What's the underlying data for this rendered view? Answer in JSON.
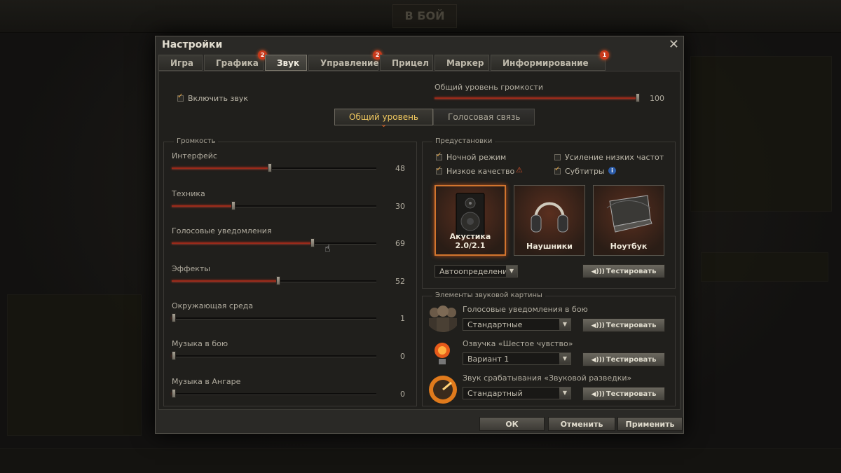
{
  "background": {
    "battle_label": "В БОЙ"
  },
  "dialog": {
    "title": "Настройки",
    "close_glyph": "✕",
    "tabs": [
      {
        "label": "Игра",
        "badge": ""
      },
      {
        "label": "Графика",
        "badge": "2"
      },
      {
        "label": "Звук",
        "badge": ""
      },
      {
        "label": "Управление",
        "badge": "2"
      },
      {
        "label": "Прицел",
        "badge": ""
      },
      {
        "label": "Маркер",
        "badge": ""
      },
      {
        "label": "Информирование в бою",
        "badge": "1"
      }
    ],
    "active_tab": "Звук"
  },
  "sound": {
    "enable_label": "Включить звук",
    "enable_checked": true,
    "master_label": "Общий уровень громкости",
    "master_value": "100",
    "master_fraction": 1.0,
    "segments": [
      "Общий уровень",
      "Голосовая связь"
    ],
    "active_segment": "Общий уровень"
  },
  "volume": {
    "title": "Громкость",
    "sliders": [
      {
        "label": "Интерфейс",
        "value": "48",
        "fraction": 0.48
      },
      {
        "label": "Техника",
        "value": "30",
        "fraction": 0.3
      },
      {
        "label": "Голосовые уведомления",
        "value": "69",
        "fraction": 0.69
      },
      {
        "label": "Эффекты",
        "value": "52",
        "fraction": 0.52
      },
      {
        "label": "Окружающая среда",
        "value": "1",
        "fraction": 0.01
      },
      {
        "label": "Музыка в бою",
        "value": "0",
        "fraction": 0.0
      },
      {
        "label": "Музыка в Ангаре",
        "value": "0",
        "fraction": 0.0
      }
    ]
  },
  "presets": {
    "title": "Предустановки",
    "options": [
      {
        "label": "Ночной режим",
        "checked": true
      },
      {
        "label": "Усиление низких частот",
        "checked": false
      },
      {
        "label": "Низкое качество",
        "checked": true
      },
      {
        "label": "Субтитры",
        "checked": true
      }
    ],
    "devices": [
      {
        "label": "Акустика 2.0/2.1",
        "active": true
      },
      {
        "label": "Наушники",
        "active": false
      },
      {
        "label": "Ноутбук",
        "active": false
      }
    ],
    "autodetect": "Автоопределение",
    "test_label": "Тестировать"
  },
  "elements": {
    "title": "Элементы звуковой картины",
    "items": [
      {
        "label": "Голосовые уведомления в бою",
        "value": "Стандартные"
      },
      {
        "label": "Озвучка «Шестое чувство»",
        "value": "Вариант 1"
      },
      {
        "label": "Звук срабатывания «Звуковой разведки»",
        "value": "Стандартный"
      }
    ],
    "test_label": "Тестировать"
  },
  "footer": {
    "ok": "ОК",
    "cancel": "Отменить",
    "apply": "Применить"
  },
  "colors": {
    "accent": "#d2752e",
    "slider_fill": "#9a2a1a",
    "badge": "#c8391b"
  }
}
